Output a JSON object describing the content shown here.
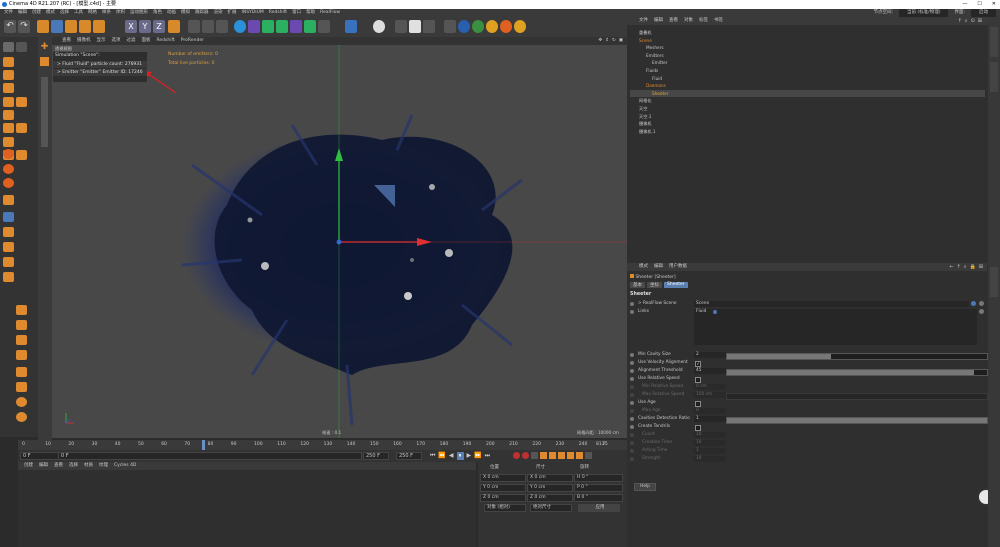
{
  "window": {
    "title": "Cinema 4D R21.207 (RC) - [模型.c4d] - 主要",
    "controls": [
      "—",
      "☐",
      "✕"
    ]
  },
  "menubar": {
    "items": [
      "文件",
      "编辑",
      "创建",
      "模式",
      "选择",
      "工具",
      "网格",
      "样条",
      "体积",
      "运动图形",
      "角色",
      "动画",
      "模拟",
      "跟踪器",
      "渲染",
      "扩展",
      "INSYDIUM",
      "Redshift",
      "窗口",
      "帮助",
      "RealFlow"
    ],
    "right_label1": "节点空间:",
    "right_value1": "当前 (标准/物理)",
    "right_label2": "界面:",
    "right_value2": "启动"
  },
  "toolbar": {
    "axis_x": "X",
    "axis_y": "Y",
    "axis_z": "Z"
  },
  "viewport": {
    "menu": [
      "查看",
      "摄像机",
      "显示",
      "选项",
      "过滤",
      "面板",
      "Redshift",
      "ProRender"
    ],
    "view_name": "透视视图",
    "info_title": "Simulation \"Scene\":",
    "info_line1": "> Fluid \"Fluid\" particle count: 276931",
    "info_line2": "> Emitter \"Emitter\" Emitter ID: 17246",
    "stats_line1": "Number of emitters: 0",
    "stats_line2": "Total live particles: 0",
    "speed_label": "帧速 : 0.1",
    "grid_label": "网格间距 : 10000 cm"
  },
  "timeline": {
    "ticks": [
      "0",
      "10",
      "20",
      "30",
      "40",
      "50",
      "60",
      "70",
      "80",
      "90",
      "100",
      "110",
      "120",
      "130",
      "140",
      "150",
      "160",
      "170",
      "180",
      "190",
      "200",
      "210",
      "220",
      "230",
      "240",
      "25"
    ],
    "current_frame": "81 F"
  },
  "transport": {
    "start_field": "0 F",
    "start_field2": "0 F",
    "end_field": "250 F",
    "end_field2": "250 F"
  },
  "bottom_left": {
    "menu": [
      "创建",
      "编辑",
      "查看",
      "选择",
      "材质",
      "纹理",
      "Cycles 4D"
    ]
  },
  "coordinates": {
    "header_pos": "位置",
    "header_size": "尺寸",
    "header_rot": "旋转",
    "x_pos": "X  0 cm",
    "y_pos": "Y  0 cm",
    "z_pos": "Z  0 cm",
    "x_size": "X  0 cm",
    "y_size": "Y  0 cm",
    "z_size": "Z  0 cm",
    "h_rot": "H  0 °",
    "p_rot": "P  0 °",
    "b_rot": "B  0 °",
    "mode_select": "对象 (相对)",
    "size_select": "绝对尺寸",
    "apply_button": "应用"
  },
  "object_manager": {
    "menu": [
      "文件",
      "编辑",
      "查看",
      "对象",
      "标签",
      "书签"
    ],
    "rows": [
      {
        "name": "重叠机",
        "indent": 0
      },
      {
        "name": "Scene",
        "indent": 0
      },
      {
        "name": "Meshers",
        "indent": 1
      },
      {
        "name": "Emitters",
        "indent": 1
      },
      {
        "name": "Emitter",
        "indent": 2
      },
      {
        "name": "Fluids",
        "indent": 1
      },
      {
        "name": "Fluid",
        "indent": 2
      },
      {
        "name": "Daemons",
        "indent": 1
      },
      {
        "name": "Sheeter",
        "indent": 2
      },
      {
        "name": "网格化",
        "indent": 0
      },
      {
        "name": "天空",
        "indent": 0
      },
      {
        "name": "天空.1",
        "indent": 0
      },
      {
        "name": "摄像机",
        "indent": 0
      },
      {
        "name": "摄像机.1",
        "indent": 0
      }
    ]
  },
  "attributes": {
    "menu": [
      "模式",
      "编辑",
      "用户数据"
    ],
    "object_title": "Sheeter [Sheeter]",
    "tabs": [
      "基本",
      "坐标",
      "Sheeter"
    ],
    "section": "Sheeter",
    "realflow_scene_label": "> RealFlow Scene",
    "realflow_scene_value": "Scene",
    "links_label": "Links",
    "links_value": "Fluid",
    "min_cavity_label": "Min Cavity Size",
    "min_cavity_value": "2",
    "use_velocity_label": "Use Velocity Alignment",
    "alignment_threshold_label": "Alignment Threshold",
    "alignment_threshold_value": "45",
    "use_relative_speed_label": "Use Relative Speed",
    "min_relative_speed_label": "Min Relative Speed",
    "min_relative_speed_value": "0 cm",
    "max_relative_speed_label": "Max Relative Speed",
    "max_relative_speed_value": "100 cm",
    "use_age_label": "Use Age",
    "max_age_label": "Max Age",
    "max_age_value": "0",
    "cavities_ratio_label": "Cavities Detection Ratio",
    "cavities_ratio_value": "1",
    "create_tendrils_label": "Create Tendrils",
    "count_label": "Count",
    "count_value": "10",
    "creation_time_label": "Creation Time",
    "creation_time_value": "10",
    "acting_time_label": "Acting Time",
    "acting_time_value": "1",
    "strength_label": "Strength",
    "strength_value": "10",
    "help_button": "Help",
    "min_cavity_fraction": 0.4,
    "alignment_fraction": 0.95,
    "cavities_fraction": 1.0
  },
  "colors": {
    "accent_blue": "#5a7fb0",
    "axis_x": "#e03030",
    "axis_y": "#30c040",
    "axis_z": "#3050e0",
    "particle": "#1a2550"
  }
}
